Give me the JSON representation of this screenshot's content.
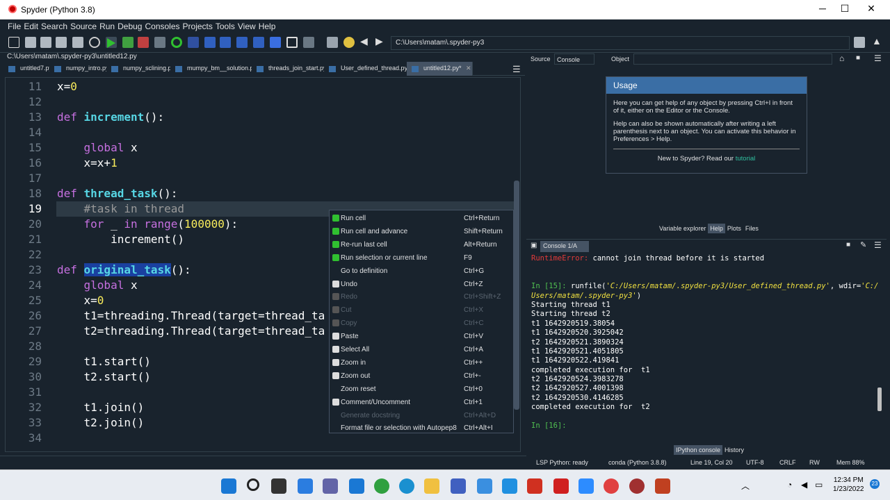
{
  "window": {
    "title": "Spyder (Python 3.8)"
  },
  "menu": [
    "File",
    "Edit",
    "Search",
    "Source",
    "Run",
    "Debug",
    "Consoles",
    "Projects",
    "Tools",
    "View",
    "Help"
  ],
  "toolbar": {
    "path": "C:\\Users\\matam\\.spyder-py3"
  },
  "editor": {
    "filepath": "C:\\Users\\matam\\.spyder-py3\\untitled12.py",
    "tabs": [
      "untitled7.py",
      "numpy_intro.py",
      "numpy_sclining.py",
      "mumpy_bm__solution.py",
      "threads_join_start.py",
      "User_defined_thread.py*",
      "untitled12.py*"
    ],
    "line_numbers": [
      "11",
      "12",
      "13",
      "14",
      "15",
      "16",
      "17",
      "18",
      "19",
      "20",
      "21",
      "22",
      "23",
      "24",
      "25",
      "26",
      "27",
      "28",
      "29",
      "30",
      "31",
      "32",
      "33",
      "34"
    ]
  },
  "context_menu": [
    {
      "label": "Run cell",
      "shortcut": "Ctrl+Return",
      "enabled": true
    },
    {
      "label": "Run cell and advance",
      "shortcut": "Shift+Return",
      "enabled": true
    },
    {
      "label": "Re-run last cell",
      "shortcut": "Alt+Return",
      "enabled": true
    },
    {
      "label": "Run selection or current line",
      "shortcut": "F9",
      "enabled": true
    },
    {
      "label": "Go to definition",
      "shortcut": "Ctrl+G",
      "enabled": true
    },
    {
      "label": "Undo",
      "shortcut": "Ctrl+Z",
      "enabled": true
    },
    {
      "label": "Redo",
      "shortcut": "Ctrl+Shift+Z",
      "enabled": false
    },
    {
      "label": "Cut",
      "shortcut": "Ctrl+X",
      "enabled": false
    },
    {
      "label": "Copy",
      "shortcut": "Ctrl+C",
      "enabled": false
    },
    {
      "label": "Paste",
      "shortcut": "Ctrl+V",
      "enabled": true
    },
    {
      "label": "Select All",
      "shortcut": "Ctrl+A",
      "enabled": true
    },
    {
      "label": "Zoom in",
      "shortcut": "Ctrl++",
      "enabled": true
    },
    {
      "label": "Zoom out",
      "shortcut": "Ctrl+-",
      "enabled": true
    },
    {
      "label": "Zoom reset",
      "shortcut": "Ctrl+0",
      "enabled": true
    },
    {
      "label": "Comment/Uncomment",
      "shortcut": "Ctrl+1",
      "enabled": true
    },
    {
      "label": "Generate docstring",
      "shortcut": "Ctrl+Alt+D",
      "enabled": false
    },
    {
      "label": "Format file or selection with Autopep8",
      "shortcut": "Ctrl+Alt+I",
      "enabled": true
    }
  ],
  "help": {
    "source_label": "Source",
    "source_value": "Console",
    "object_label": "Object",
    "usage_title": "Usage",
    "p1": "Here you can get help of any object by pressing Ctrl+I in front of it, either on the Editor or the Console.",
    "p2": "Help can also be shown automatically after writing a left parenthesis next to an object. You can activate this behavior in Preferences > Help.",
    "new_prefix": "New to Spyder? Read our ",
    "tutorial": "tutorial",
    "tabs": [
      "Variable explorer",
      "Help",
      "Plots",
      "Files"
    ]
  },
  "console": {
    "tab": "Console 1/A",
    "bottom_tabs": [
      "IPython console",
      "History"
    ]
  },
  "statusbar": {
    "lsp": "LSP Python: ready",
    "conda": "conda (Python 3.8.8)",
    "pos": "Line 19, Col 20",
    "enc": "UTF-8",
    "eol": "CRLF",
    "rw": "RW",
    "mem": "Mem 88%"
  },
  "taskbar": {
    "time": "12:34 PM",
    "date": "1/23/2022",
    "badge": "23"
  }
}
